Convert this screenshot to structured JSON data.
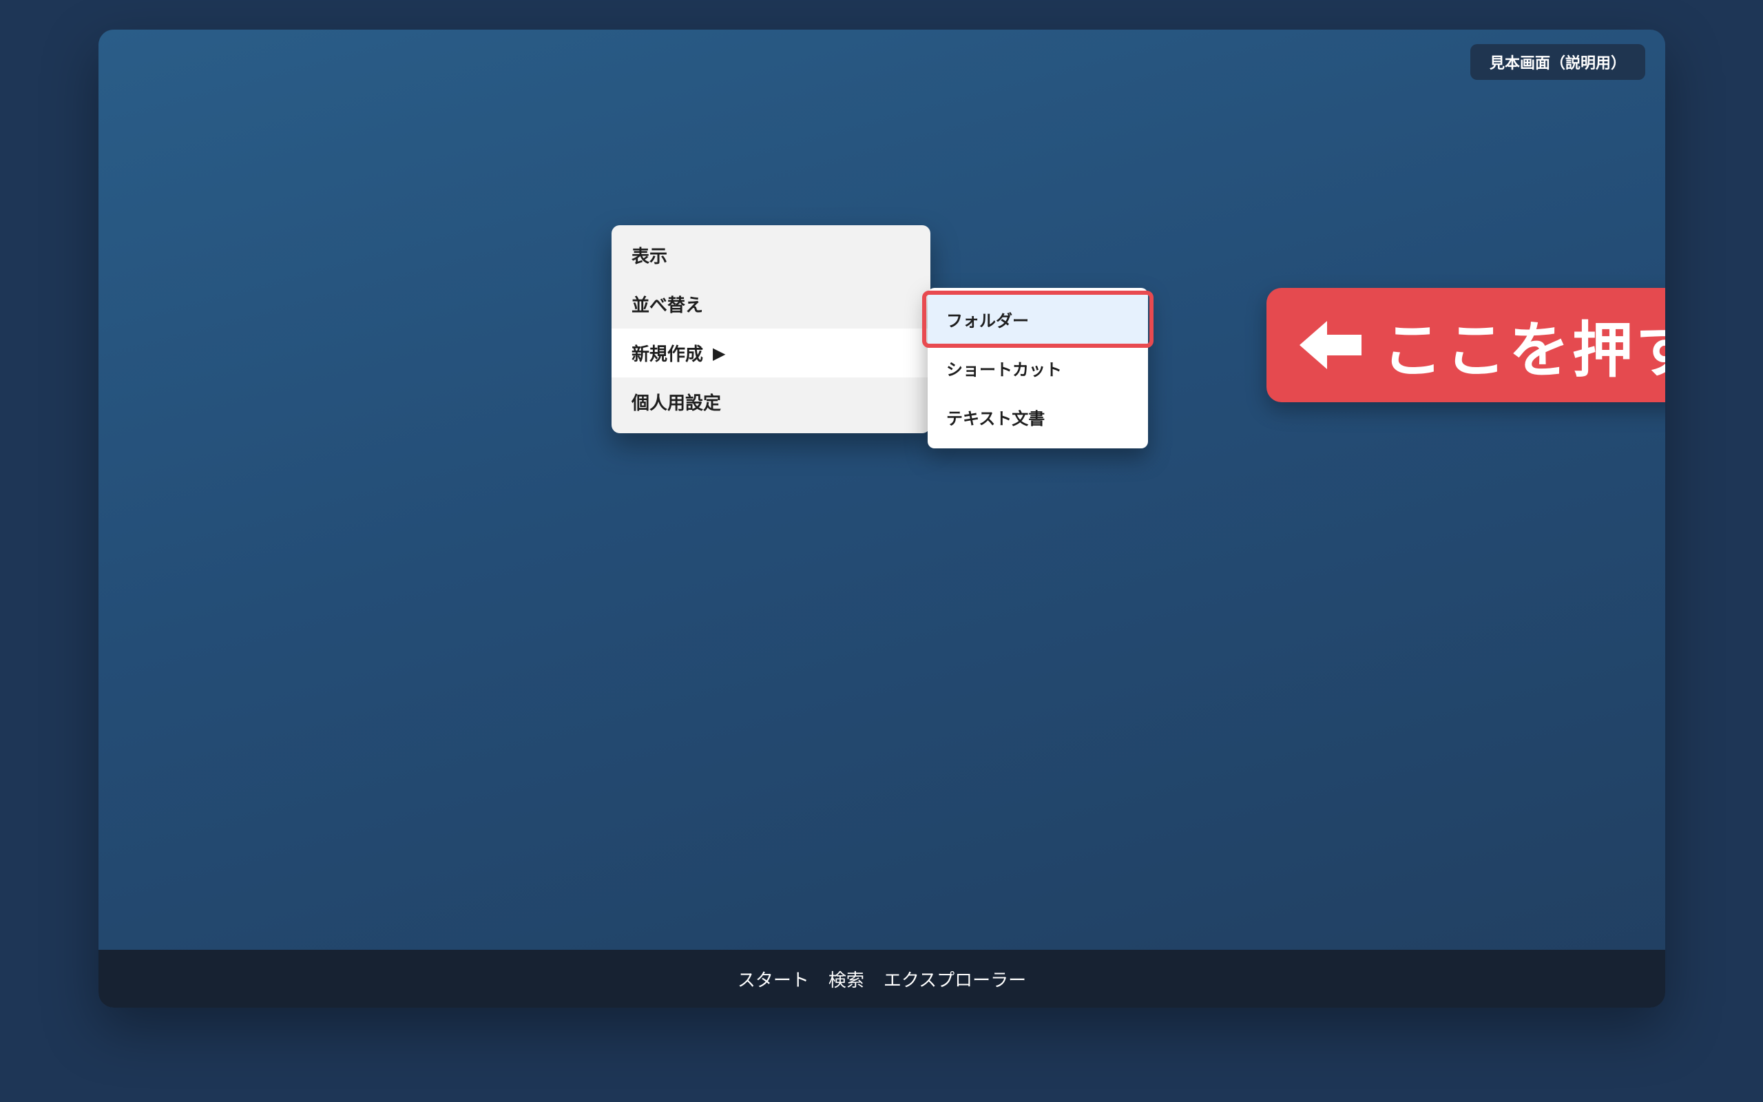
{
  "badge": {
    "label": "見本画面（説明用）"
  },
  "context_menu": {
    "items": [
      {
        "label": "表示"
      },
      {
        "label": "並べ替え"
      },
      {
        "label": "新規作成",
        "submenu_arrow": "▶"
      },
      {
        "label": "個人用設定"
      }
    ]
  },
  "submenu": {
    "items": [
      {
        "label": "フォルダー"
      },
      {
        "label": "ショートカット"
      },
      {
        "label": "テキスト文書"
      }
    ]
  },
  "callout": {
    "text": "ここを押す",
    "icon": "left-arrow-icon"
  },
  "taskbar": {
    "items": [
      {
        "label": "スタート"
      },
      {
        "label": "検索"
      },
      {
        "label": "エクスプローラー"
      }
    ]
  },
  "colors": {
    "accent_red": "#e54a4f",
    "highlight_blue": "#e6f1fd",
    "desktop_blue": "#244d76",
    "taskbar": "#172232"
  }
}
